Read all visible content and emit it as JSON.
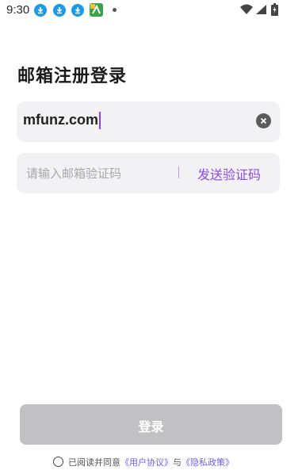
{
  "status_bar": {
    "time": "9:30",
    "icons": [
      "download-icon",
      "download-icon",
      "download-icon",
      "app-icon",
      "dot-icon",
      "wifi-icon",
      "signal-icon",
      "battery-icon"
    ],
    "colors": {
      "download": "#1a9be8",
      "app": "#3ea24a"
    }
  },
  "page": {
    "title": "邮箱注册登录"
  },
  "email_field": {
    "value": "mfunz.com"
  },
  "code_field": {
    "placeholder": "请输入邮箱验证码",
    "send_label": "发送验证码"
  },
  "login_button": {
    "label": "登录"
  },
  "agreement": {
    "prefix": "已阅读并同意",
    "user_agreement": "《用户协议》",
    "and": "与",
    "privacy_policy": "《隐私政策》"
  },
  "colors": {
    "accent": "#8a4bf0",
    "link": "#6b5ff0",
    "button_disabled": "#c1c1c3",
    "field_bg": "#f2f2f4"
  }
}
